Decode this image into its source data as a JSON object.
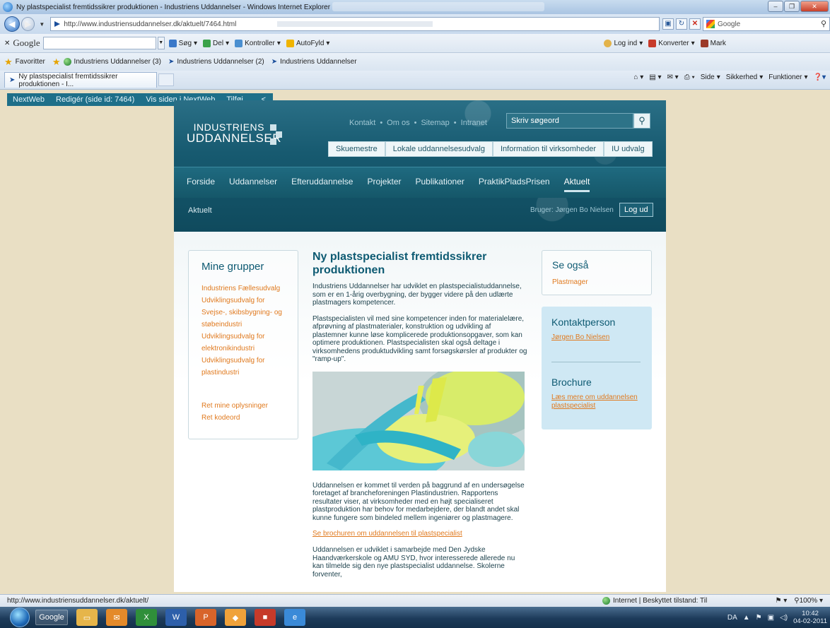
{
  "window": {
    "title": "Ny plastspecialist fremtidssikrer produktionen - Industriens Uddannelser - Windows Internet Explorer"
  },
  "addressbar": {
    "url": "http://www.industriensuddannelser.dk/aktuelt/7464.html",
    "search_placeholder": "Google"
  },
  "google_toolbar": {
    "logo": "Google",
    "items": [
      "Søg",
      "Del",
      "Kontroller",
      "AutoFyld"
    ],
    "right_items": [
      "Log ind",
      "Konverter",
      "Mark"
    ]
  },
  "favorites": {
    "label": "Favoritter",
    "items": [
      "Industriens Uddannelser (3)",
      "Industriens Uddannelser (2)",
      "Industriens Uddannelser"
    ]
  },
  "tab": {
    "label": "Ny plastspecialist fremtidssikrer produktionen - I..."
  },
  "commandbar": {
    "items": [
      "Side",
      "Sikkerhed",
      "Funktioner"
    ]
  },
  "nextweb": {
    "items": [
      "NextWeb",
      "Redigér (side id: 7464)",
      "Vis siden i NextWeb",
      "Tilføj"
    ],
    "collapse": "<"
  },
  "site": {
    "logo_line1": "INDUSTRIENS",
    "logo_line2": "UDDANNELSER",
    "toplinks": [
      "Kontakt",
      "Om os",
      "Sitemap",
      "Intranet"
    ],
    "search_placeholder": "Skriv søgeord",
    "pills": [
      "Skuemestre",
      "Lokale uddannelsesudvalg",
      "Information til virksomheder",
      "IU udvalg"
    ],
    "mainnav": [
      "Forside",
      "Uddannelser",
      "Efteruddannelse",
      "Projekter",
      "Publikationer",
      "PraktikPladsPrisen",
      "Aktuelt"
    ],
    "breadcrumb": "Aktuelt",
    "user_label": "Bruger: Jørgen Bo Nielsen",
    "logout": "Log ud"
  },
  "leftbox": {
    "title": "Mine grupper",
    "links": [
      "Industriens Fællesudvalg",
      "Udviklingsudvalg for",
      "Svejse-, skibsbygning- og",
      "støbeindustri",
      "Udviklingsudvalg for",
      "elektronikindustri",
      "Udviklingsudvalg for",
      "plastindustri"
    ],
    "account_links": [
      "Ret mine oplysninger",
      "Ret kodeord"
    ]
  },
  "article": {
    "title": "Ny plastspecialist fremtidssikrer produktionen",
    "p1": "Industriens Uddannelser har udviklet en plastspecialistuddannelse, som er en 1-årig overbygning, der bygger videre på den udlærte plastmagers kompetencer.",
    "p2": "Plastspecialisten vil med sine kompetencer inden for materialelære, afprøvning af plastmaterialer, konstruktion og udvikling af plastemner kunne løse komplicerede produktionsopgaver, som kan optimere produktionen. Plastspecialisten skal også deltage i virksomhedens produktudvikling samt forsøgskørsler af produkter og \"ramp-up\".",
    "p3": "Uddannelsen er kommet til verden på baggrund af en undersøgelse foretaget af brancheforeningen Plastindustrien. Rapportens resultater viser, at virksomheder med en højt specialiseret plastproduktion har behov for medarbejdere, der blandt andet skal kunne fungere som bindeled mellem ingeniører og plastmagere.",
    "link": "Se brochuren om uddannelsen til plastspecialist",
    "p4": "Uddannelsen er udviklet i samarbejde med Den Jydske Haandværkerskole og AMU SYD, hvor interesserede allerede nu kan tilmelde sig den nye plastspecialist uddannelse. Skolerne forventer,"
  },
  "see_also": {
    "title": "Se også",
    "link": "Plastmager"
  },
  "contact": {
    "title": "Kontaktperson",
    "person": "Jørgen Bo Nielsen",
    "brochure_title": "Brochure",
    "brochure_link": "Læs mere om uddannelsen plastspecialist"
  },
  "statusbar": {
    "url": "http://www.industriensuddannelser.dk/aktuelt/",
    "zone": "Internet | Beskyttet tilstand: Til",
    "zoom": "100%"
  },
  "taskbar": {
    "google": "Google",
    "lang": "DA",
    "time": "10:42",
    "date": "04-02-2011"
  }
}
